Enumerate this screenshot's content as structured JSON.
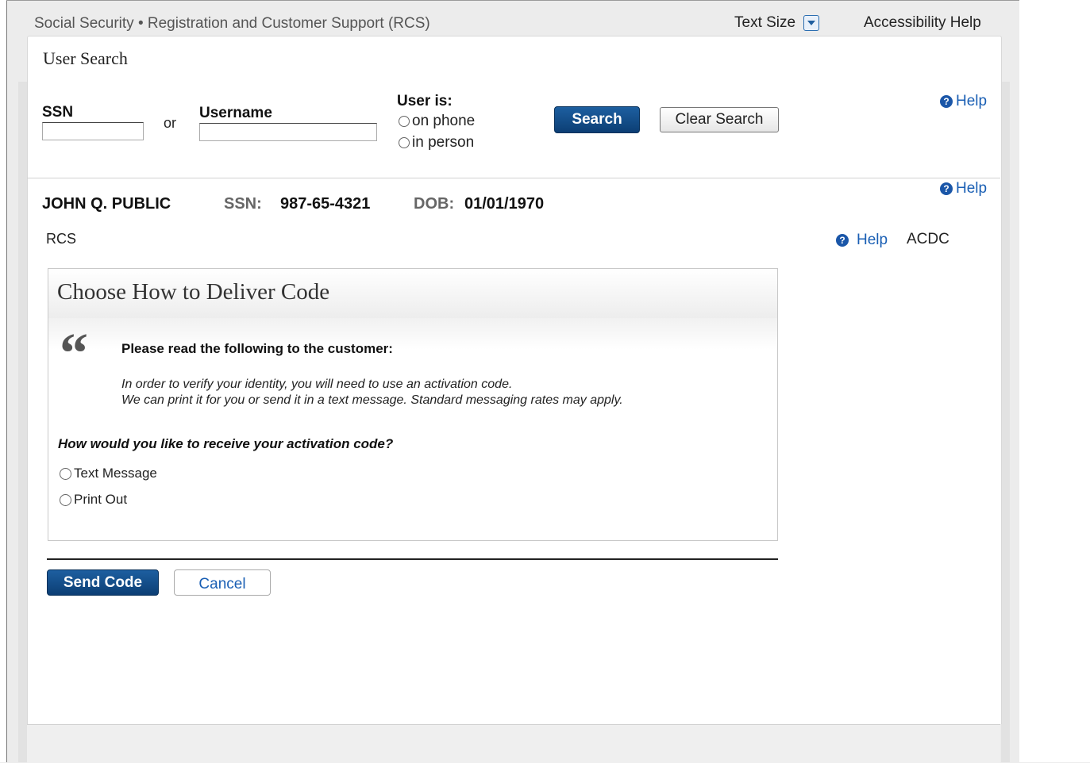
{
  "header": {
    "title": "Social Security • Registration and Customer Support (RCS)",
    "text_size_label": "Text Size",
    "accessibility_help": "Accessibility Help"
  },
  "page": {
    "title": "User Search"
  },
  "search": {
    "ssn_label": "SSN",
    "ssn_value": "",
    "or_text": "or",
    "username_label": "Username",
    "username_value": "",
    "user_is_label": "User is:",
    "options": [
      "on phone",
      "in person"
    ],
    "search_button": "Search",
    "clear_button": "Clear Search",
    "help_label": "Help"
  },
  "customer": {
    "name": "JOHN Q. PUBLIC",
    "ssn_label": "SSN:",
    "ssn_value": "987-65-4321",
    "dob_label": "DOB:",
    "dob_value": "01/01/1970",
    "help_label": "Help"
  },
  "context": {
    "left_label": "RCS",
    "help_label": "Help",
    "right_label": "ACDC"
  },
  "panel": {
    "title": "Choose How to Deliver Code",
    "quote_glyph": "“",
    "instruction": "Please read the following to the customer:",
    "script_lines": [
      "In order to verify your identity, you will need to use an activation code.",
      "We can print it for you or send it in a text message. Standard messaging rates may apply."
    ],
    "question": "How would you like to receive your activation code?",
    "options": [
      "Text Message",
      "Print Out"
    ]
  },
  "actions": {
    "send_code": "Send Code",
    "cancel": "Cancel"
  },
  "colors": {
    "primary_button": "#0c3e74",
    "link": "#1a5fb4",
    "background": "#ececec"
  },
  "icons": {
    "help": "help-icon",
    "text_size": "chevron-down-icon"
  }
}
